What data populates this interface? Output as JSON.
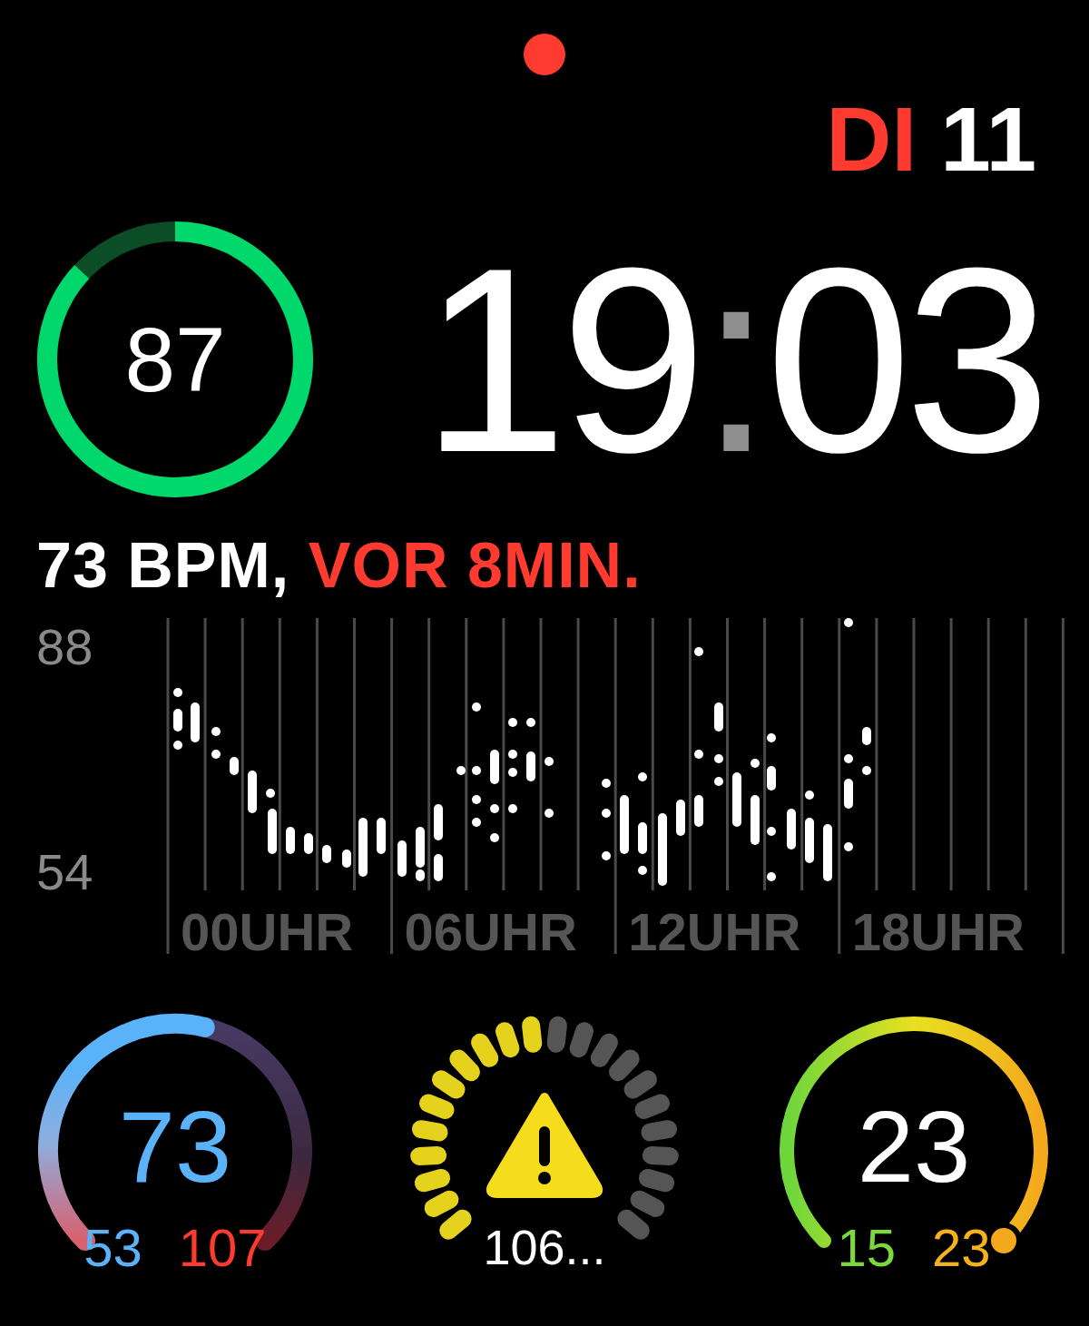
{
  "date": {
    "weekday": "DI",
    "day": "11"
  },
  "activity": {
    "value": "87"
  },
  "time": {
    "hours": "19",
    "separator": ":",
    "minutes": "03"
  },
  "heart_rate": {
    "reading": "73 BPM,",
    "age": "VOR 8MIN.",
    "y_labels": [
      "88",
      "54"
    ],
    "x_labels": [
      "00UHR",
      "06UHR",
      "12UHR",
      "18UHR"
    ]
  },
  "complications": [
    {
      "kind": "range",
      "value": "73",
      "min": "53",
      "max": "107"
    },
    {
      "kind": "segments",
      "level": 0.5,
      "label": "106..."
    },
    {
      "kind": "gauge",
      "value": "23",
      "min": "15",
      "max": "23"
    }
  ]
}
